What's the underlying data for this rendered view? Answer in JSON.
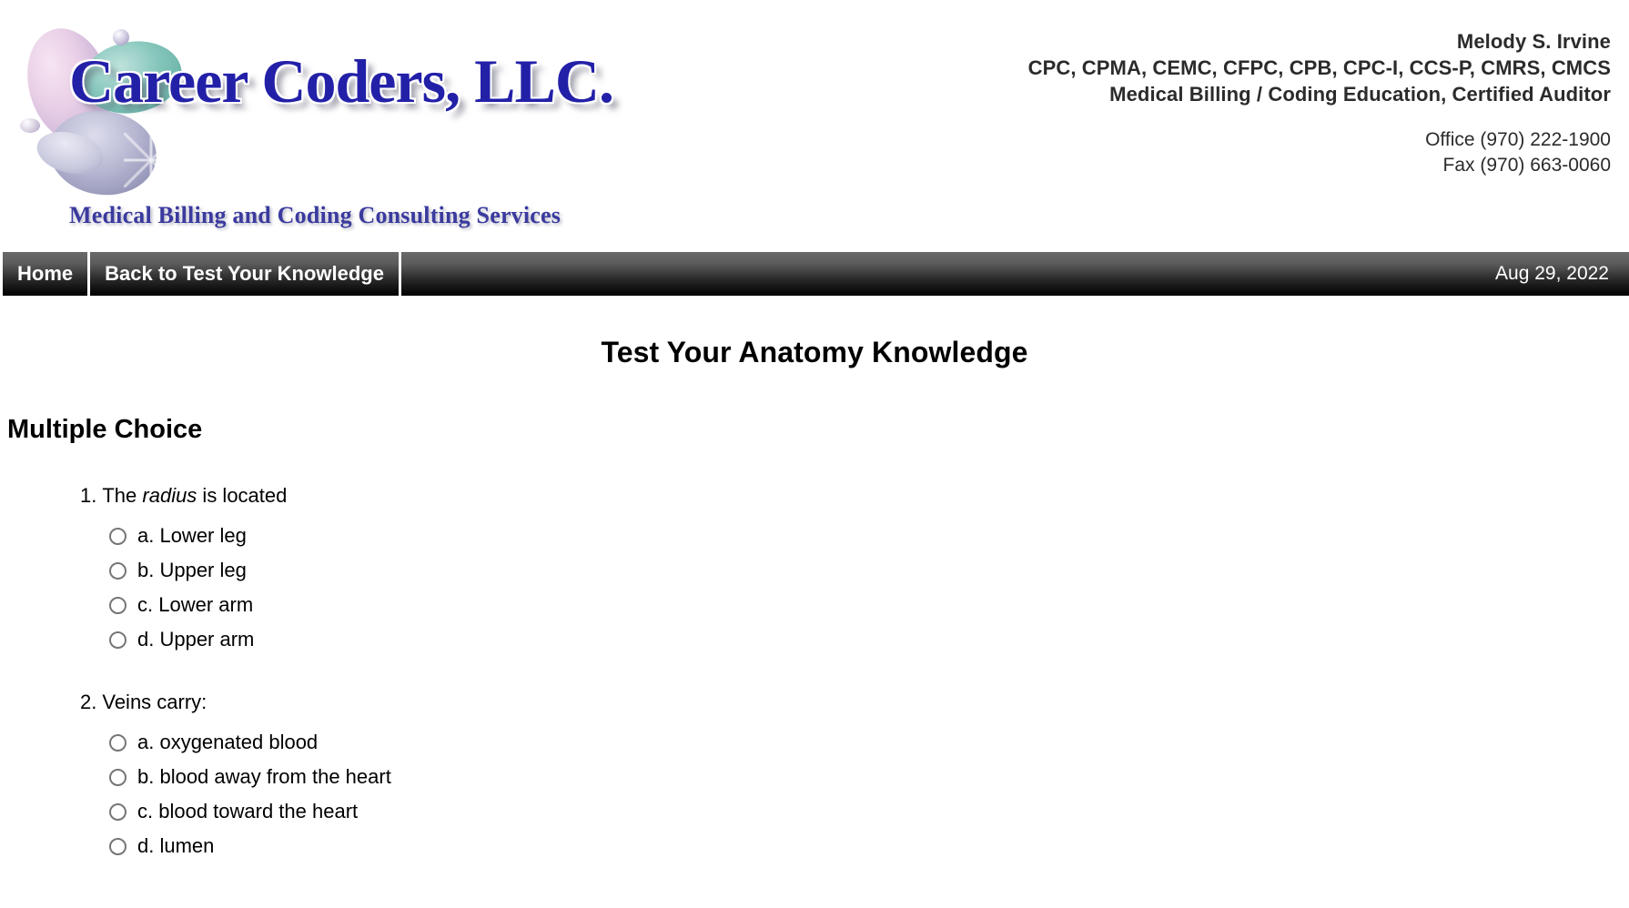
{
  "header": {
    "logo": {
      "wordmark": "Career Coders, LLC.",
      "tagline": "Medical Billing and Coding Consulting Services",
      "art_name": "career-coders-logo-graphic"
    },
    "contact": {
      "name": "Melody S. Irvine",
      "credentials": "CPC, CPMA, CEMC, CFPC, CPB, CPC-I, CCS-P, CMRS, CMCS",
      "role": "Medical Billing / Coding Education, Certified Auditor",
      "office_phone": "Office (970) 222-1900",
      "fax_phone": "Fax (970) 663-0060"
    }
  },
  "navbar": {
    "items": [
      {
        "label": "Home"
      },
      {
        "label": "Back to Test Your Knowledge"
      }
    ],
    "date": "Aug 29, 2022"
  },
  "main": {
    "page_title": "Test Your Anatomy Knowledge",
    "section_title": "Multiple Choice",
    "questions": [
      {
        "number": "1.",
        "text_before": "The ",
        "text_italic": "radius",
        "text_after": " is located",
        "options": [
          {
            "label": "a. Lower leg",
            "selected": false
          },
          {
            "label": "b. Upper leg",
            "selected": false
          },
          {
            "label": "c. Lower arm",
            "selected": false
          },
          {
            "label": "d. Upper arm",
            "selected": false
          }
        ]
      },
      {
        "number": "2.",
        "text_before": "Veins carry:",
        "text_italic": "",
        "text_after": "",
        "options": [
          {
            "label": "a. oxygenated blood",
            "selected": false
          },
          {
            "label": "b. blood away from the heart",
            "selected": false
          },
          {
            "label": "c. blood toward the heart",
            "selected": false
          },
          {
            "label": "d. lumen",
            "selected": false
          }
        ]
      }
    ]
  },
  "colors": {
    "logo_blue": "#2320a8",
    "tagline_blue": "#3a3a9e",
    "nav_text": "#ffffff",
    "contact_text": "#2b2b2b"
  }
}
